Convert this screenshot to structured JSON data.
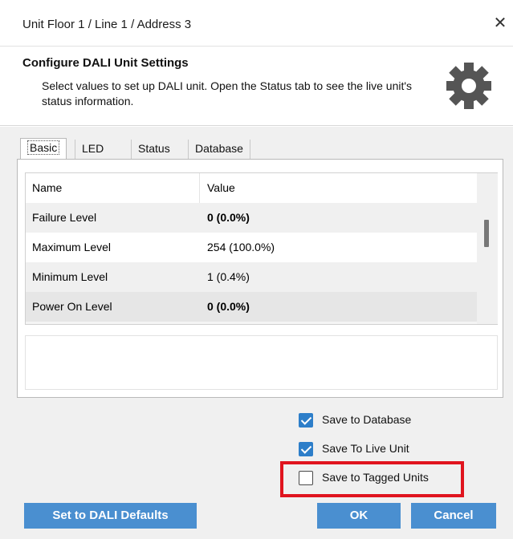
{
  "window": {
    "title": "Unit Floor 1 / Line 1 / Address 3",
    "close_glyph": "✕"
  },
  "header": {
    "heading": "Configure DALI Unit Settings",
    "description": "Select values to set up DALI unit. Open the Status tab to see the live unit's status information.",
    "icon": "gear-icon"
  },
  "tabs": [
    {
      "label": "Basic",
      "active": true
    },
    {
      "label": "LED",
      "active": false
    },
    {
      "label": "Status",
      "active": false
    },
    {
      "label": "Database",
      "active": false
    }
  ],
  "grid": {
    "columns": [
      "Name",
      "Value"
    ],
    "rows": [
      {
        "name": "Failure Level",
        "value": "0 (0.0%)",
        "bold": true
      },
      {
        "name": "Maximum Level",
        "value": "254 (100.0%)",
        "bold": false
      },
      {
        "name": "Minimum Level",
        "value": "1 (0.4%)",
        "bold": false
      },
      {
        "name": "Power On Level",
        "value": "0 (0.0%)",
        "bold": true
      }
    ]
  },
  "options": [
    {
      "label": "Save to Database",
      "checked": true
    },
    {
      "label": "Save To Live Unit",
      "checked": true
    },
    {
      "label": "Save to Tagged Units",
      "checked": false
    }
  ],
  "buttons": {
    "defaults": "Set to DALI Defaults",
    "ok": "OK",
    "cancel": "Cancel"
  },
  "colors": {
    "accent": "#4a8fd0",
    "checkbox": "#2d7ec9",
    "highlight": "#e0141e"
  }
}
